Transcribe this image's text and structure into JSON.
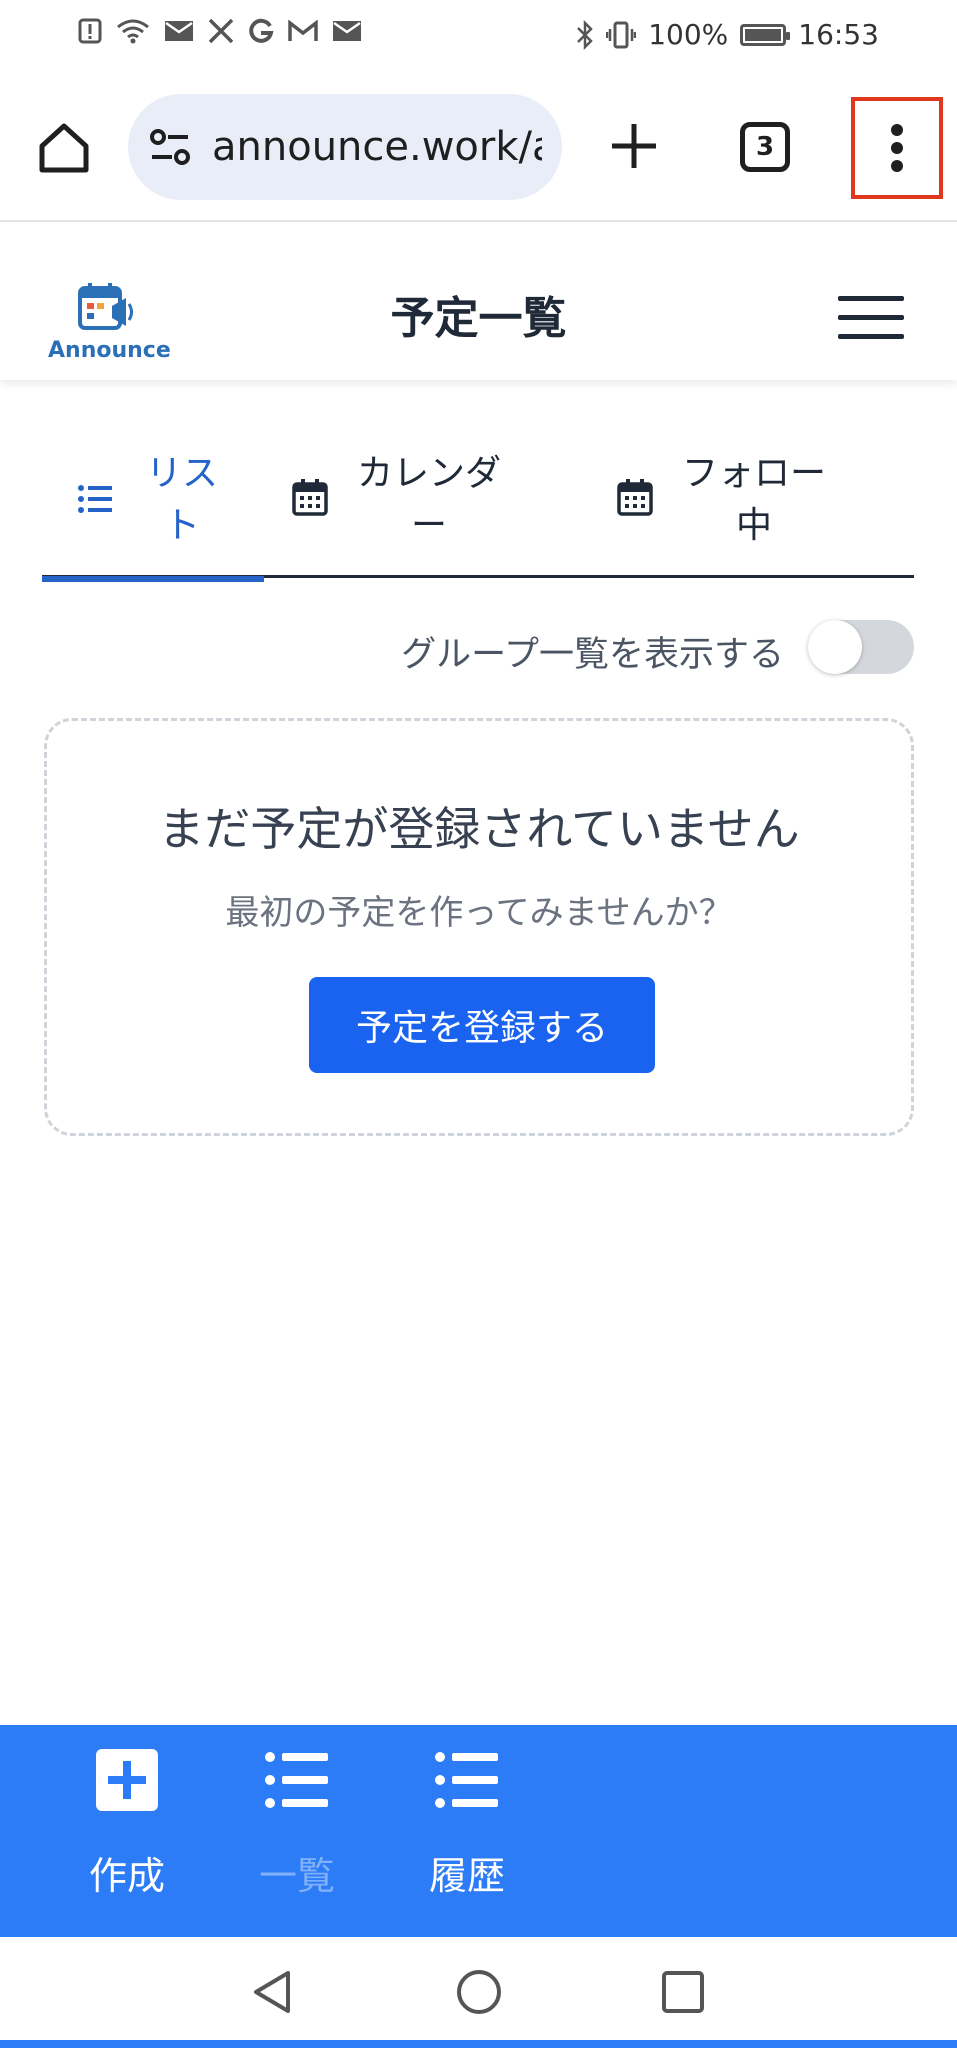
{
  "status_bar": {
    "battery": "100%",
    "time": "16:53",
    "icons": [
      "alert-icon",
      "wifi-icon",
      "mail-icon",
      "x-icon",
      "google-icon",
      "gmail-icon",
      "mail-icon",
      "bluetooth-icon",
      "vibrate-icon",
      "battery-icon"
    ]
  },
  "browser": {
    "url": "announce.work/a",
    "tab_count": "3"
  },
  "header": {
    "logo_text": "Announce",
    "title": "予定一覧"
  },
  "tabs": [
    {
      "label": "リスト",
      "icon": "list-icon",
      "active": true
    },
    {
      "label": "カレンダー",
      "icon": "calendar-icon",
      "active": false
    },
    {
      "label": "フォロー中",
      "icon": "calendar-icon",
      "active": false
    }
  ],
  "toggle": {
    "label": "グループ一覧を表示する",
    "on": false
  },
  "empty_state": {
    "title": "まだ予定が登録されていません",
    "subtitle": "最初の予定を作ってみませんか？",
    "button": "予定を登録する"
  },
  "bottom_nav": [
    {
      "label": "作成",
      "icon": "plus-square-icon"
    },
    {
      "label": "一覧",
      "icon": "list-icon"
    },
    {
      "label": "履歴",
      "icon": "list-icon"
    }
  ],
  "colors": {
    "accent": "#2563c9",
    "primary_button": "#1a63f0",
    "bottom_nav": "#2c7cf7",
    "highlight": "#e0371f"
  }
}
